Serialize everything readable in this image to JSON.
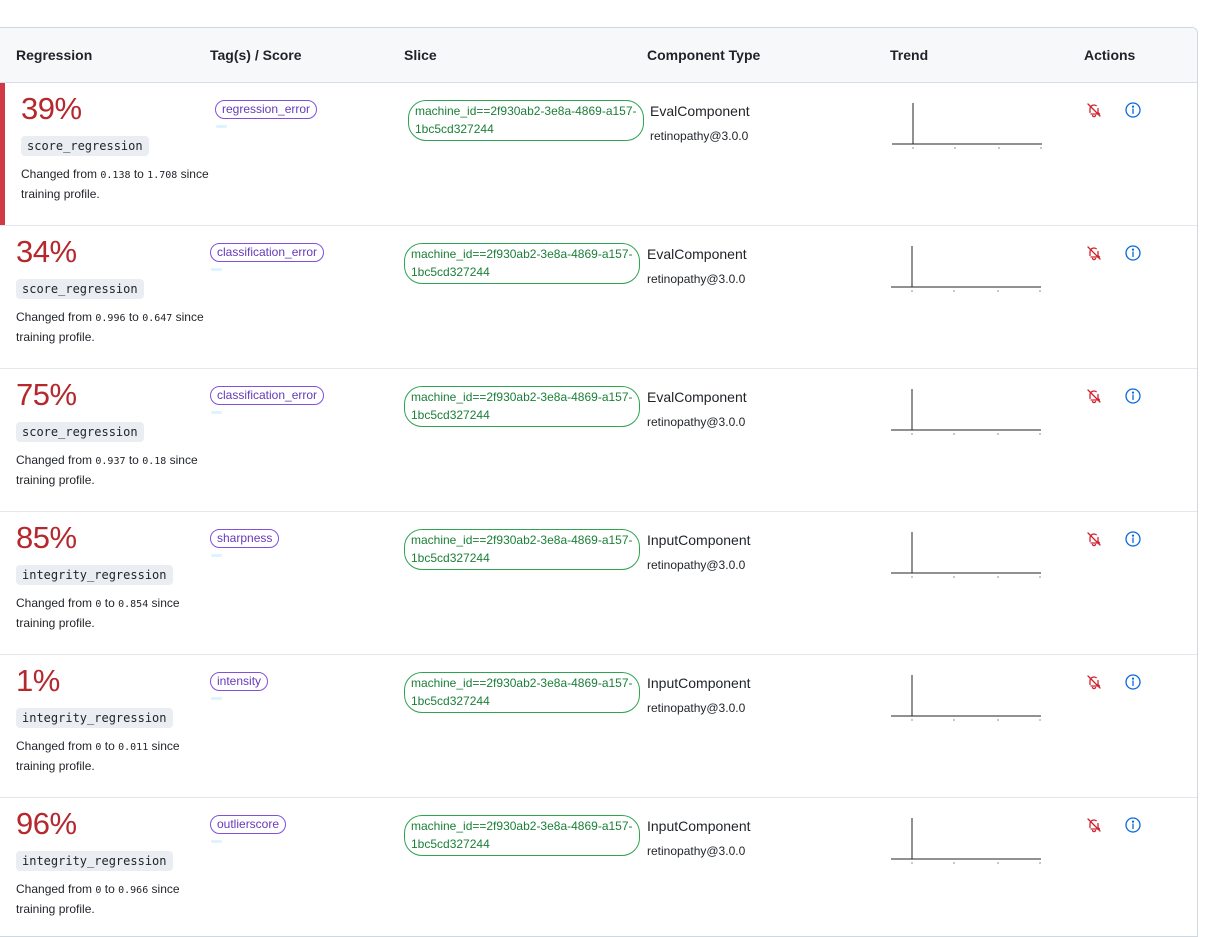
{
  "header": {
    "regression": "Regression",
    "tags": "Tag(s) / Score",
    "slice": "Slice",
    "component_type": "Component Type",
    "trend": "Trend",
    "actions": "Actions"
  },
  "colors": {
    "regression_red": "#b4282e",
    "active_accent": "#cf3a44",
    "tag_purple": "#8250df",
    "slice_green": "#1a7f37",
    "mute_icon_red": "#cf222e",
    "info_icon_blue": "#0969da"
  },
  "icons": {
    "mute": "bell-slash-icon",
    "info": "info-icon"
  },
  "rows": [
    {
      "percent": "39%",
      "metric": "score_regression",
      "change_prefix": "Changed from ",
      "from": "0.138",
      "to_word": " to ",
      "to": "1.708",
      "change_suffix": " since training profile.",
      "tag": "regression_error",
      "slice": "machine_id==2f930ab2-3e8a-4869-a157-1bc5cd327244",
      "component": "EvalComponent",
      "component_sub": "retinopathy@3.0.0",
      "active": true
    },
    {
      "percent": "34%",
      "metric": "score_regression",
      "change_prefix": "Changed from ",
      "from": "0.996",
      "to_word": " to ",
      "to": "0.647",
      "change_suffix": " since training profile.",
      "tag": "classification_error",
      "slice": "machine_id==2f930ab2-3e8a-4869-a157-1bc5cd327244",
      "component": "EvalComponent",
      "component_sub": "retinopathy@3.0.0",
      "active": false
    },
    {
      "percent": "75%",
      "metric": "score_regression",
      "change_prefix": "Changed from ",
      "from": "0.937",
      "to_word": " to ",
      "to": "0.18",
      "change_suffix": " since training profile.",
      "tag": "classification_error",
      "slice": "machine_id==2f930ab2-3e8a-4869-a157-1bc5cd327244",
      "component": "EvalComponent",
      "component_sub": "retinopathy@3.0.0",
      "active": false
    },
    {
      "percent": "85%",
      "metric": "integrity_regression",
      "change_prefix": "Changed from ",
      "from": "0",
      "to_word": " to ",
      "to": "0.854",
      "change_suffix": " since training profile.",
      "tag": "sharpness",
      "slice": "machine_id==2f930ab2-3e8a-4869-a157-1bc5cd327244",
      "component": "InputComponent",
      "component_sub": "retinopathy@3.0.0",
      "active": false
    },
    {
      "percent": "1%",
      "metric": "integrity_regression",
      "change_prefix": "Changed from ",
      "from": "0",
      "to_word": " to ",
      "to": "0.011",
      "change_suffix": " since training profile.",
      "tag": "intensity",
      "slice": "machine_id==2f930ab2-3e8a-4869-a157-1bc5cd327244",
      "component": "InputComponent",
      "component_sub": "retinopathy@3.0.0",
      "active": false
    },
    {
      "percent": "96%",
      "metric": "integrity_regression",
      "change_prefix": "Changed from ",
      "from": "0",
      "to_word": " to ",
      "to": "0.966",
      "change_suffix": " since training profile.",
      "tag": "outlierscore",
      "slice": "machine_id==2f930ab2-3e8a-4869-a157-1bc5cd327244",
      "component": "InputComponent",
      "component_sub": "retinopathy@3.0.0",
      "active": false
    }
  ]
}
